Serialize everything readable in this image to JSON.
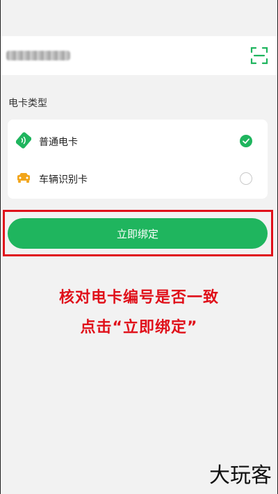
{
  "card_number": {
    "scan_icon": "scan-frame-icon",
    "accent_color": "#1fb55e"
  },
  "card_type": {
    "title": "电卡类型",
    "options": [
      {
        "label": "普通电卡",
        "icon": "green-card-icon",
        "selected": true
      },
      {
        "label": "车辆识别卡",
        "icon": "car-icon",
        "selected": false
      }
    ]
  },
  "actions": {
    "bind_label": "立即绑定"
  },
  "annotation": {
    "line1": "核对电卡编号是否一致",
    "line2": "点击“立即绑定”",
    "color": "#e0101a"
  },
  "watermark": {
    "text": "大玩客"
  }
}
